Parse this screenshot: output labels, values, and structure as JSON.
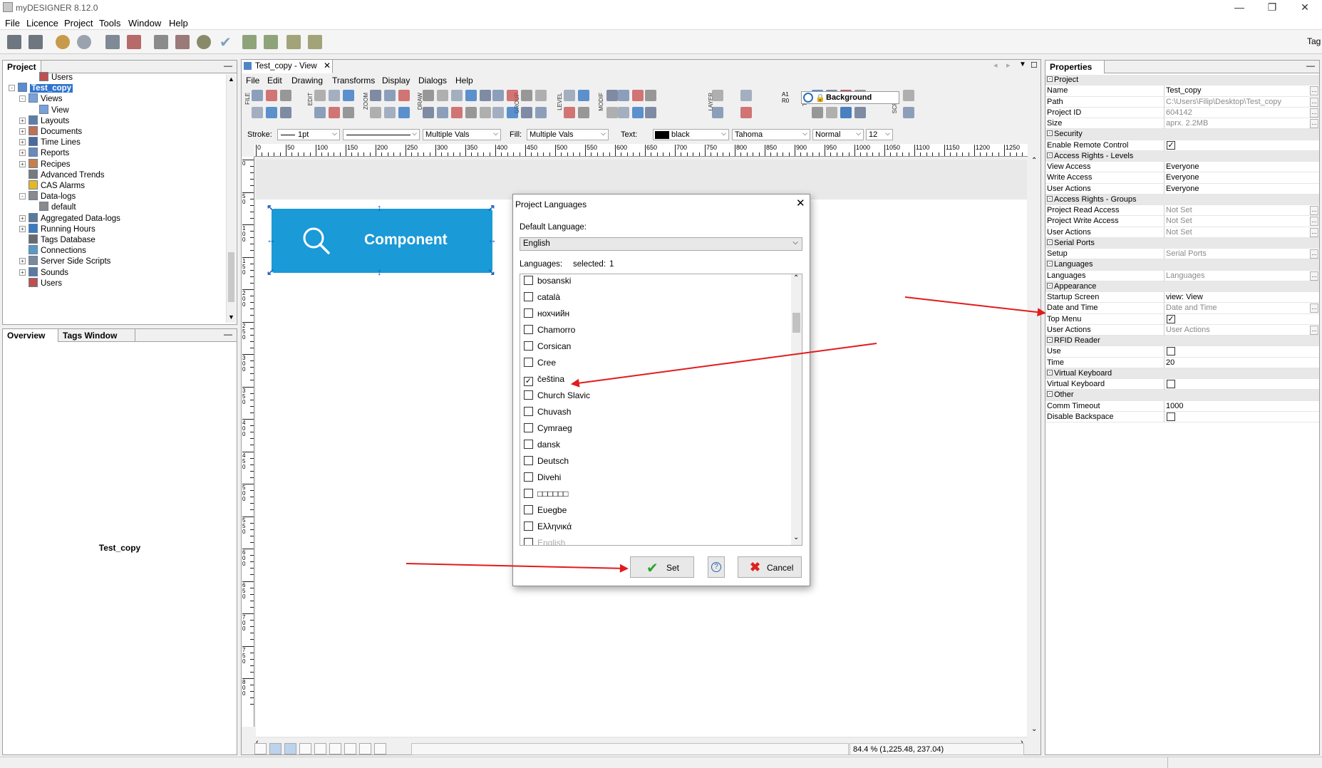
{
  "window": {
    "title": "myDESIGNER 8.12.0",
    "min": "—",
    "restore": "❐",
    "close": "✕"
  },
  "menu": [
    "File",
    "Licence",
    "Project",
    "Tools",
    "Window",
    "Help"
  ],
  "toolbar": {
    "tag_label": "Tag"
  },
  "project_panel": {
    "tab": "Project",
    "tree": [
      {
        "label": "Users",
        "icon": "users-icon",
        "depth": 2,
        "exp": false
      },
      {
        "label": "Test_copy",
        "icon": "project-icon",
        "depth": 0,
        "exp": "-",
        "selected": true
      },
      {
        "label": "Views",
        "icon": "views-icon",
        "depth": 1,
        "exp": "-"
      },
      {
        "label": "View",
        "icon": "view-icon",
        "depth": 2,
        "exp": false
      },
      {
        "label": "Layouts",
        "icon": "layouts-icon",
        "depth": 1,
        "exp": "+"
      },
      {
        "label": "Documents",
        "icon": "documents-icon",
        "depth": 1,
        "exp": "+"
      },
      {
        "label": "Time Lines",
        "icon": "timelines-icon",
        "depth": 1,
        "exp": "+"
      },
      {
        "label": "Reports",
        "icon": "reports-icon",
        "depth": 1,
        "exp": "+"
      },
      {
        "label": "Recipes",
        "icon": "recipes-icon",
        "depth": 1,
        "exp": "+"
      },
      {
        "label": "Advanced Trends",
        "icon": "trends-icon",
        "depth": 1,
        "exp": false
      },
      {
        "label": "CAS Alarms",
        "icon": "alarm-icon",
        "depth": 1,
        "exp": false
      },
      {
        "label": "Data-logs",
        "icon": "datalogs-icon",
        "depth": 1,
        "exp": "-"
      },
      {
        "label": "default",
        "icon": "datalog-icon",
        "depth": 2,
        "exp": false
      },
      {
        "label": "Aggregated Data-logs",
        "icon": "aggregated-icon",
        "depth": 1,
        "exp": "+"
      },
      {
        "label": "Running Hours",
        "icon": "clock-icon",
        "depth": 1,
        "exp": "+"
      },
      {
        "label": "Tags Database",
        "icon": "database-icon",
        "depth": 1,
        "exp": false
      },
      {
        "label": "Connections",
        "icon": "connections-icon",
        "depth": 1,
        "exp": false
      },
      {
        "label": "Server Side Scripts",
        "icon": "scripts-icon",
        "depth": 1,
        "exp": "+"
      },
      {
        "label": "Sounds",
        "icon": "sounds-icon",
        "depth": 1,
        "exp": "+"
      },
      {
        "label": "Users",
        "icon": "users-icon",
        "depth": 1,
        "exp": false
      }
    ]
  },
  "overview_panel": {
    "tabs": [
      "Overview",
      "Tags Window"
    ],
    "caption": "Test_copy"
  },
  "designer": {
    "tab_title": "Test_copy - View",
    "menu": [
      "File",
      "Edit",
      "Drawing",
      "Transforms",
      "Display",
      "Dialogs",
      "Help"
    ],
    "group_labels": [
      "FILE",
      "EDIT",
      "ZOOM",
      "DRAW",
      "GROUP",
      "LEVEL",
      "MODIF",
      "LAYER",
      "TIME",
      "SCRIPT"
    ],
    "background_label": "Background",
    "a1r0": "A1 R0",
    "props": {
      "stroke_label": "Stroke:",
      "stroke_width": "1pt",
      "stroke_multi": "Multiple Vals",
      "fill_label": "Fill:",
      "fill_value": "Multiple Vals",
      "text_label": "Text:",
      "text_color": "black",
      "font": "Tahoma",
      "weight": "Normal",
      "size": "12"
    },
    "ruler_marks": [
      "0",
      "50",
      "100",
      "150",
      "200",
      "250",
      "300",
      "350",
      "400",
      "450",
      "500",
      "550",
      "600",
      "650",
      "700",
      "750",
      "800",
      "850",
      "900",
      "950",
      "1000",
      "1050",
      "1100",
      "1150",
      "1200",
      "1250"
    ],
    "vruler_marks": [
      "0",
      "50",
      "100",
      "150",
      "200",
      "250",
      "300",
      "350",
      "400",
      "450",
      "500",
      "550",
      "600",
      "650",
      "700",
      "750",
      "800"
    ],
    "component_label": "Component",
    "status": "84.4 % (1,225.48, 237.04)"
  },
  "dialog": {
    "title": "Project Languages",
    "default_language_label": "Default Language:",
    "default_language": "English",
    "languages_label": "Languages:",
    "selected_label": "selected:",
    "selected_count": "1",
    "languages": [
      {
        "name": "bosanski",
        "checked": false
      },
      {
        "name": "català",
        "checked": false
      },
      {
        "name": "нохчийн",
        "checked": false
      },
      {
        "name": "Chamorro",
        "checked": false
      },
      {
        "name": "Corsican",
        "checked": false
      },
      {
        "name": "Cree",
        "checked": false
      },
      {
        "name": "čeština",
        "checked": true
      },
      {
        "name": "Church Slavic",
        "checked": false
      },
      {
        "name": "Chuvash",
        "checked": false
      },
      {
        "name": "Cymraeg",
        "checked": false
      },
      {
        "name": "dansk",
        "checked": false
      },
      {
        "name": "Deutsch",
        "checked": false
      },
      {
        "name": "Divehi",
        "checked": false
      },
      {
        "name": "□□□□□□",
        "checked": false
      },
      {
        "name": "Eʋegbe",
        "checked": false
      },
      {
        "name": "Ελληνικά",
        "checked": false
      },
      {
        "name": "English",
        "checked": false,
        "disabled": true
      }
    ],
    "set_label": "Set",
    "help_label": "?",
    "cancel_label": "Cancel"
  },
  "properties": {
    "title": "Properties",
    "rows": [
      {
        "type": "group",
        "label": "Project"
      },
      {
        "label": "Name",
        "value": "Test_copy",
        "dots": true
      },
      {
        "label": "Path",
        "value": "C:\\Users\\Filip\\Desktop\\Test_copy",
        "grey": true,
        "dots": true
      },
      {
        "label": "Project ID",
        "value": "604142",
        "grey": true,
        "dots": true
      },
      {
        "label": "Size",
        "value": "aprx. 2.2MB",
        "grey": true,
        "dots": true
      },
      {
        "type": "group",
        "label": "Security"
      },
      {
        "label": "Enable Remote Control",
        "check": true
      },
      {
        "type": "group",
        "label": "Access Rights - Levels"
      },
      {
        "label": "View Access",
        "value": "Everyone"
      },
      {
        "label": "Write Access",
        "value": "Everyone"
      },
      {
        "label": "User Actions",
        "value": "Everyone"
      },
      {
        "type": "group",
        "label": "Access Rights - Groups"
      },
      {
        "label": "Project Read Access",
        "value": "Not Set",
        "grey": true,
        "dots": true
      },
      {
        "label": "Project Write Access",
        "value": "Not Set",
        "grey": true,
        "dots": true
      },
      {
        "label": "User Actions",
        "value": "Not Set",
        "grey": true,
        "dots": true
      },
      {
        "type": "group",
        "label": "Serial Ports"
      },
      {
        "label": "Setup",
        "value": "Serial Ports",
        "grey": true,
        "dots": true
      },
      {
        "type": "group",
        "label": "Languages"
      },
      {
        "label": "Languages",
        "value": "Languages",
        "grey": true,
        "dots": true
      },
      {
        "type": "group",
        "label": "Appearance"
      },
      {
        "label": "Startup Screen",
        "value": "view: View"
      },
      {
        "label": "Date and Time",
        "value": "Date and Time",
        "grey": true,
        "dots": true
      },
      {
        "label": "Top Menu",
        "check": true
      },
      {
        "label": "User Actions",
        "value": "User Actions",
        "grey": true,
        "dots": true
      },
      {
        "type": "group",
        "label": "RFID Reader"
      },
      {
        "label": "Use",
        "check": false
      },
      {
        "label": "Time",
        "value": "20"
      },
      {
        "type": "group",
        "label": "Virtual Keyboard"
      },
      {
        "label": "Virtual Keyboard",
        "check": false
      },
      {
        "type": "group",
        "label": "Other"
      },
      {
        "label": "Comm Timeout",
        "value": "1000"
      },
      {
        "label": "Disable Backspace",
        "check": false
      }
    ]
  }
}
